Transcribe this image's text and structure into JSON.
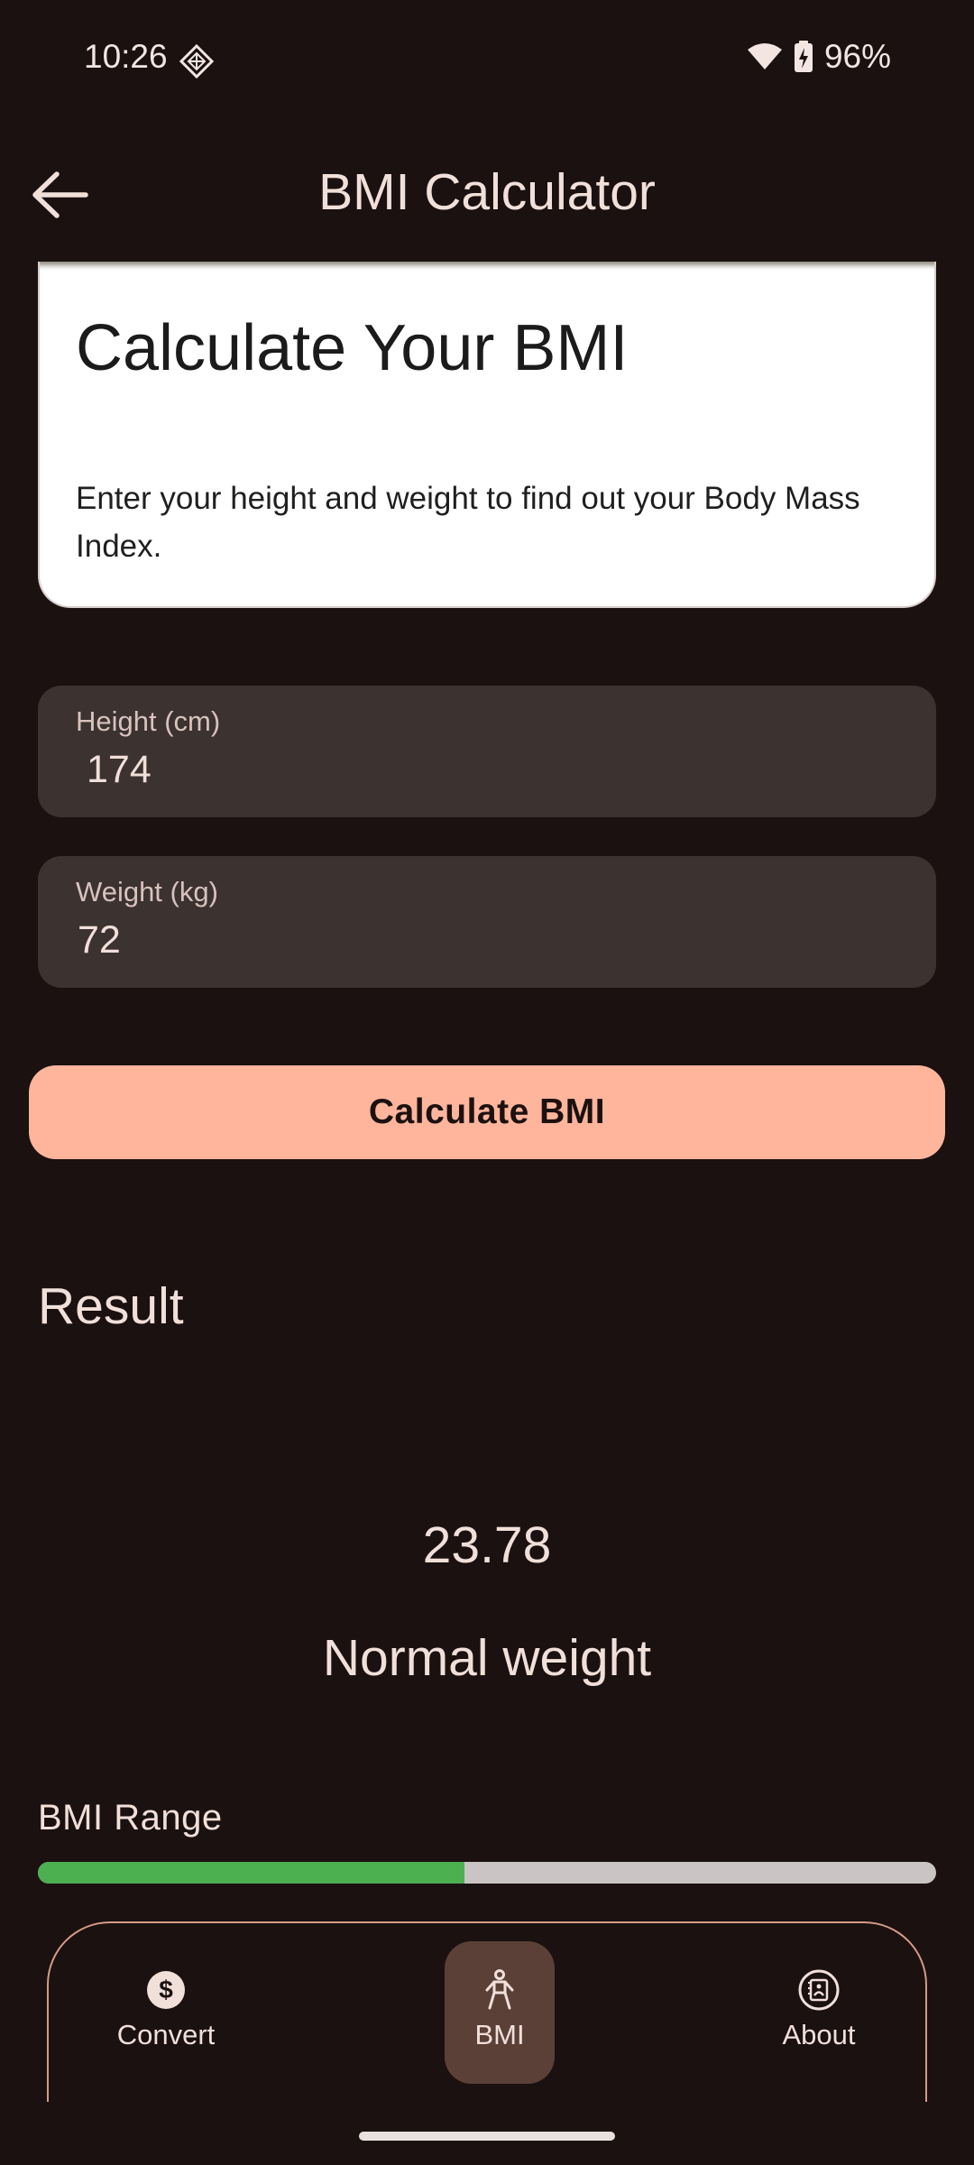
{
  "status_bar": {
    "time": "10:26",
    "battery": "96%",
    "icons": [
      "diamond-notification-icon",
      "wifi-icon",
      "battery-charging-icon"
    ]
  },
  "app_bar": {
    "title": "BMI Calculator",
    "back_icon": "arrow-back-icon"
  },
  "card": {
    "title": "Calculate Your BMI",
    "description": "Enter your height and weight to find out your Body Mass Index."
  },
  "form": {
    "height": {
      "label": "Height (cm)",
      "value": "174"
    },
    "weight": {
      "label": "Weight (kg)",
      "value": "72"
    },
    "submit_label": "Calculate BMI"
  },
  "result": {
    "heading": "Result",
    "bmi_value": "23.78",
    "category": "Normal weight",
    "range_label": "BMI Range",
    "range_fill_fraction": 0.475
  },
  "bottom_nav": {
    "items": [
      {
        "label": "Convert",
        "icon": "dollar-icon",
        "selected": false
      },
      {
        "label": "BMI",
        "icon": "person-icon",
        "selected": true
      },
      {
        "label": "About",
        "icon": "info-book-icon",
        "selected": false
      }
    ]
  },
  "colors": {
    "background": "#1a1110",
    "accent": "#ffb59c",
    "range_fill": "#4caf50",
    "range_track": "#cac5c4",
    "nav_selected": "#5b4038"
  }
}
